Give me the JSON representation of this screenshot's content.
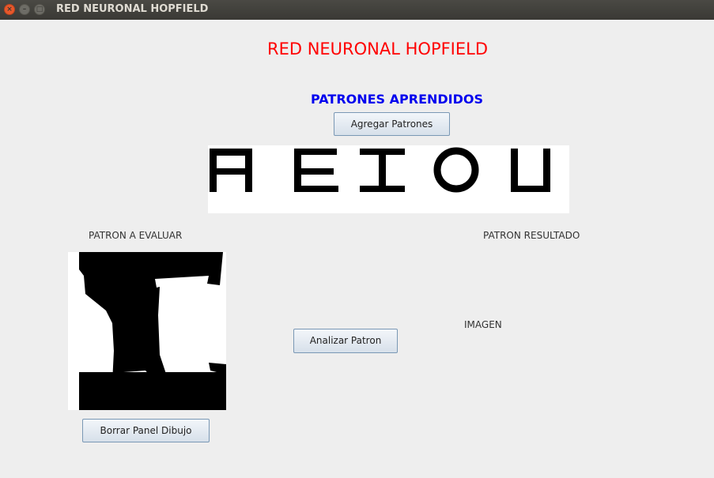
{
  "window": {
    "title": "RED NEURONAL HOPFIELD"
  },
  "header": {
    "title": "RED NEURONAL HOPFIELD",
    "subtitle": "PATRONES APRENDIDOS"
  },
  "buttons": {
    "add_patterns": "Agregar Patrones",
    "analyze": "Analizar Patron",
    "clear_draw": "Borrar Panel Dibujo"
  },
  "learned_patterns": [
    "A",
    "E",
    "I",
    "O",
    "U"
  ],
  "evaluate": {
    "label": "PATRON A EVALUAR"
  },
  "result": {
    "label": "PATRON RESULTADO",
    "image_text": "IMAGEN"
  },
  "colors": {
    "title": "#ff0000",
    "subtitle": "#0000ee",
    "title_bar": "#3d3c38",
    "background": "#eeeeee"
  }
}
